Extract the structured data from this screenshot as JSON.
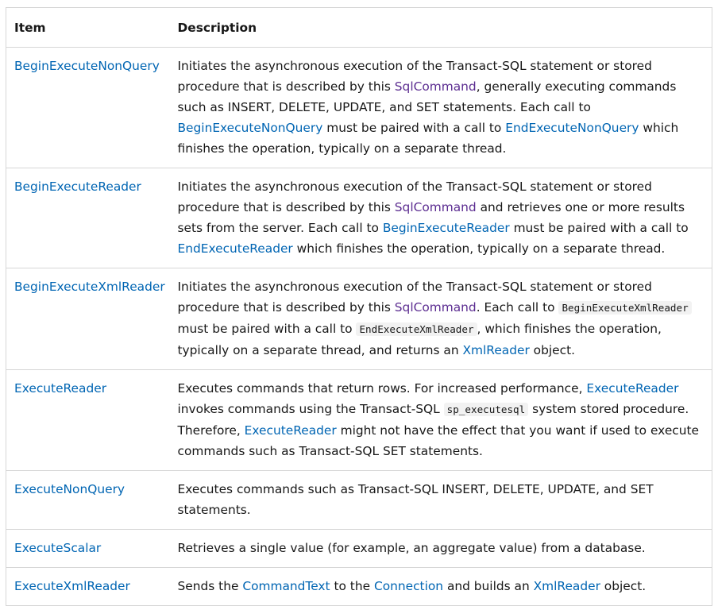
{
  "table": {
    "headers": {
      "item": "Item",
      "description": "Description"
    },
    "rows": [
      {
        "item": "BeginExecuteNonQuery",
        "desc": [
          {
            "t": "text",
            "v": "Initiates the asynchronous execution of the Transact-SQL statement or stored procedure that is described by this "
          },
          {
            "t": "vlink",
            "v": "SqlCommand"
          },
          {
            "t": "text",
            "v": ", generally executing commands such as INSERT, DELETE, UPDATE, and SET statements. Each call to "
          },
          {
            "t": "link",
            "v": "BeginExecuteNonQuery"
          },
          {
            "t": "text",
            "v": " must be paired with a call to "
          },
          {
            "t": "link",
            "v": "EndExecuteNonQuery"
          },
          {
            "t": "text",
            "v": " which finishes the operation, typically on a separate thread."
          }
        ]
      },
      {
        "item": "BeginExecuteReader",
        "desc": [
          {
            "t": "text",
            "v": "Initiates the asynchronous execution of the Transact-SQL statement or stored procedure that is described by this "
          },
          {
            "t": "vlink",
            "v": "SqlCommand"
          },
          {
            "t": "text",
            "v": " and retrieves one or more results sets from the server. Each call to "
          },
          {
            "t": "link",
            "v": "BeginExecuteReader"
          },
          {
            "t": "text",
            "v": " must be paired with a call to "
          },
          {
            "t": "link",
            "v": "EndExecuteReader"
          },
          {
            "t": "text",
            "v": " which finishes the operation, typically on a separate thread."
          }
        ]
      },
      {
        "item": "BeginExecuteXmlReader",
        "desc": [
          {
            "t": "text",
            "v": "Initiates the asynchronous execution of the Transact-SQL statement or stored procedure that is described by this "
          },
          {
            "t": "vlink",
            "v": "SqlCommand"
          },
          {
            "t": "text",
            "v": ". Each call to "
          },
          {
            "t": "code",
            "v": "BeginExecuteXmlReader"
          },
          {
            "t": "text",
            "v": " must be paired with a call to "
          },
          {
            "t": "code",
            "v": "EndExecuteXmlReader"
          },
          {
            "t": "text",
            "v": ", which finishes the operation, typically on a separate thread, and returns an "
          },
          {
            "t": "link",
            "v": "XmlReader"
          },
          {
            "t": "text",
            "v": " object."
          }
        ]
      },
      {
        "item": "ExecuteReader",
        "desc": [
          {
            "t": "text",
            "v": "Executes commands that return rows. For increased performance, "
          },
          {
            "t": "link",
            "v": "ExecuteReader"
          },
          {
            "t": "text",
            "v": " invokes commands using the Transact-SQL "
          },
          {
            "t": "code",
            "v": "sp_executesql"
          },
          {
            "t": "text",
            "v": " system stored procedure. Therefore, "
          },
          {
            "t": "link",
            "v": "ExecuteReader"
          },
          {
            "t": "text",
            "v": " might not have the effect that you want if used to execute commands such as Transact-SQL SET statements."
          }
        ]
      },
      {
        "item": "ExecuteNonQuery",
        "desc": [
          {
            "t": "text",
            "v": "Executes commands such as Transact-SQL INSERT, DELETE, UPDATE, and SET statements."
          }
        ]
      },
      {
        "item": "ExecuteScalar",
        "desc": [
          {
            "t": "text",
            "v": "Retrieves a single value (for example, an aggregate value) from a database."
          }
        ]
      },
      {
        "item": "ExecuteXmlReader",
        "desc": [
          {
            "t": "text",
            "v": "Sends the "
          },
          {
            "t": "link",
            "v": "CommandText"
          },
          {
            "t": "text",
            "v": " to the "
          },
          {
            "t": "link",
            "v": "Connection"
          },
          {
            "t": "text",
            "v": " and builds an "
          },
          {
            "t": "link",
            "v": "XmlReader"
          },
          {
            "t": "text",
            "v": " object."
          }
        ]
      }
    ]
  },
  "colors": {
    "link": "#0065b3",
    "visited_link": "#5c2d91",
    "border": "#d6d6d6",
    "code_bg": "#f2f2f2",
    "text": "#171717"
  }
}
